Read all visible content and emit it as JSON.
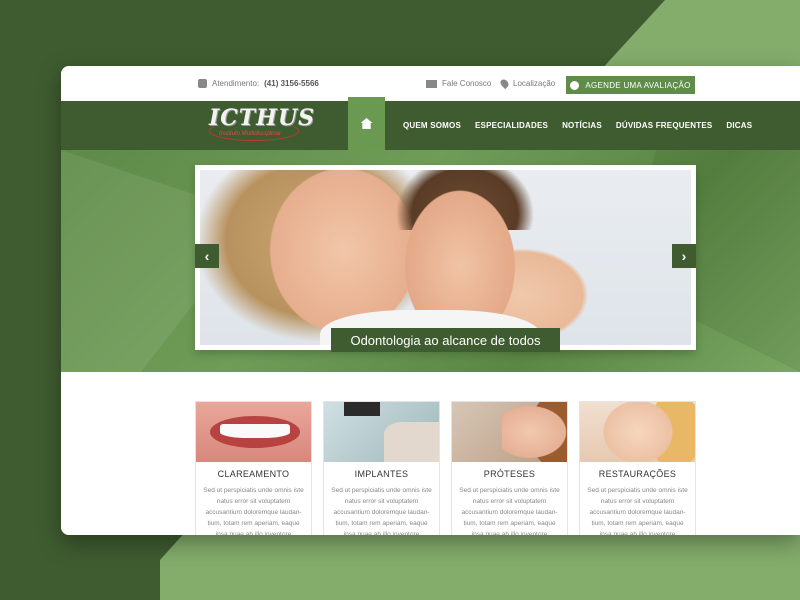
{
  "topbar": {
    "atendimento_label": "Atendimento:",
    "phone": "(41) 3156-5566",
    "contact_label": "Fale Conosco",
    "location_label": "Localização",
    "cta_label": "AGENDE UMA AVALIAÇÃO"
  },
  "logo": {
    "name": "ICTHUS",
    "tagline": "Instituto Multidisciplinar"
  },
  "nav": {
    "items": [
      "QUEM SOMOS",
      "ESPECIALIDADES",
      "NOTÍCIAS",
      "DÚVIDAS FREQUENTES",
      "DICAS"
    ]
  },
  "hero": {
    "caption": "Odontologia ao alcance de todos",
    "prev_glyph": "‹",
    "next_glyph": "›"
  },
  "services": [
    {
      "title": "CLAREAMENTO",
      "text": "Sed ut perspiciatis unde omnis iste natus error sit voluptatem accusantium doloremque laudan-tium, totam rem aperiam, eaque ipsa quae ab illo inventore"
    },
    {
      "title": "IMPLANTES",
      "text": "Sed ut perspiciatis unde omnis iste natus error sit voluptatem accusantium doloremque laudan-tium, totam rem aperiam, eaque ipsa quae ab illo inventore"
    },
    {
      "title": "PRÓTESES",
      "text": "Sed ut perspiciatis unde omnis iste natus error sit voluptatem accusantium doloremque laudan-tium, totam rem aperiam, eaque ipsa quae ab illo inventore"
    },
    {
      "title": "RESTAURAÇÕES",
      "text": "Sed ut perspiciatis unde omnis iste natus error sit voluptatem accusantium doloremque laudan-tium, totam rem aperiam, eaque ipsa quae ab illo inventore"
    }
  ],
  "colors": {
    "dark_green": "#3f5c30",
    "accent_green": "#5f8c4b",
    "light_green": "#84ad6c"
  },
  "icons": [
    "phone-icon",
    "mail-icon",
    "pin-icon",
    "user-icon",
    "home-icon",
    "arrow-left-icon",
    "arrow-right-icon"
  ]
}
